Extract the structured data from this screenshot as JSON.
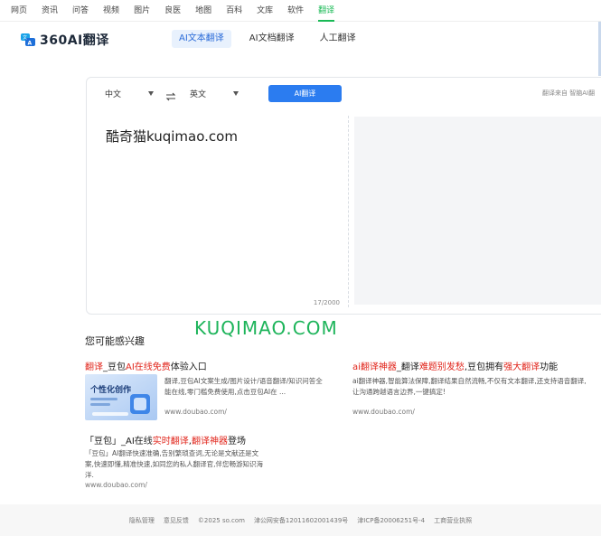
{
  "topnav": {
    "items": [
      "网页",
      "资讯",
      "问答",
      "视频",
      "图片",
      "良医",
      "地图",
      "百科",
      "文库",
      "软件",
      "翻译"
    ],
    "active_index": 10
  },
  "header": {
    "logo_text": "360AI翻译",
    "tabs": [
      "AI文本翻译",
      "AI文档翻译",
      "人工翻译"
    ],
    "active_tab": 0
  },
  "translator": {
    "source_lang": "中文",
    "target_lang": "英文",
    "ai_button": "AI翻译",
    "source_note": "翻译来自 智脑AI翻",
    "input_text": "酷奇猫kuqimao.com",
    "counter": "17/2000"
  },
  "watermark": "KUQIMAO.COM",
  "recommendations": {
    "title": "您可能感兴趣",
    "items": [
      {
        "title_parts": [
          "翻译",
          "_豆包",
          "AI在线免费",
          "体验入口"
        ],
        "desc": "翻译,豆包AI文案生成/图片设计/语音翻译/知识问答全能在线,零门槛免费使用,点击豆包AI在 ...",
        "url": "www.doubao.com/",
        "image_text": "个性化创作"
      },
      {
        "title_parts": [
          "ai翻译神器",
          "_翻译",
          "难题别发愁",
          ",豆包拥有",
          "强大翻译",
          "功能"
        ],
        "desc": "ai翻译神器,智能算法保障,翻译结果自然流畅,不仅有文本翻译,还支持语音翻译,让沟通跨越语言边界,一键搞定!",
        "url": "www.doubao.com/"
      },
      {
        "title_parts": [
          "「豆包」_AI在线",
          "实时翻译",
          ",",
          "翻译神器",
          "登场"
        ],
        "desc": "「豆包」AI翻译快速准确,告别繁琐查词,无论是文献还是文案,快速即懂,精准快速,如同您的私人翻译官,伴您畅游知识海洋.",
        "url": "www.doubao.com/"
      }
    ]
  },
  "footer": {
    "items": [
      "隐私管理",
      "意见反馈",
      "©2025 so.com",
      "津公网安备12011602001439号",
      "津ICP备20006251号-4",
      "工商营业执照"
    ]
  },
  "colors": {
    "accent_green": "#19b955",
    "accent_blue": "#2b7cf0",
    "highlight_red": "#e1251b"
  }
}
